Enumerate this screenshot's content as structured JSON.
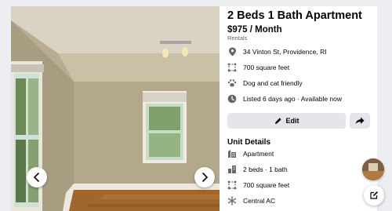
{
  "listing": {
    "title": "2 Beds 1 Bath Apartment",
    "price": "$975 / Month",
    "category": "Rentals",
    "details": [
      {
        "icon": "location-pin-icon",
        "text": "34 Vinton St, Providence, RI"
      },
      {
        "icon": "square-footage-icon",
        "text": "700 square feet"
      },
      {
        "icon": "paw-icon",
        "text": "Dog and cat friendly"
      },
      {
        "icon": "clock-icon",
        "text": "Listed 6 days ago · Available now"
      }
    ],
    "edit_label": "Edit"
  },
  "unit_details": {
    "heading": "Unit Details",
    "items": [
      {
        "icon": "apartment-icon",
        "text": "Apartment"
      },
      {
        "icon": "building-icon",
        "text": "2 beds · 1 bath"
      },
      {
        "icon": "square-footage-icon",
        "text": "700 square feet"
      },
      {
        "icon": "snowflake-icon",
        "text": "Central AC"
      }
    ]
  },
  "colors": {
    "text_primary": "#050505",
    "text_secondary": "#65676b",
    "icon_gray": "#65676b",
    "button_bg": "#e4e6eb"
  }
}
